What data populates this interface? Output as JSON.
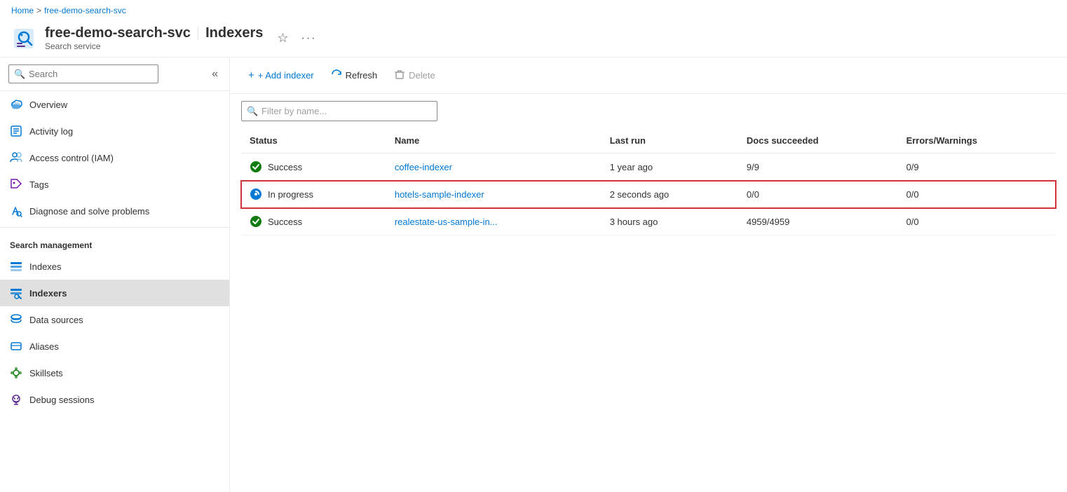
{
  "breadcrumb": {
    "home": "Home",
    "separator": ">",
    "current": "free-demo-search-svc"
  },
  "header": {
    "service_name": "free-demo-search-svc",
    "separator": "|",
    "page_title": "Indexers",
    "subtitle": "Search service",
    "star_label": "☆",
    "more_label": "···"
  },
  "sidebar": {
    "search_placeholder": "Search",
    "collapse_icon": "«",
    "items": [
      {
        "id": "overview",
        "label": "Overview",
        "icon": "cloud"
      },
      {
        "id": "activity-log",
        "label": "Activity log",
        "icon": "list"
      },
      {
        "id": "access-control",
        "label": "Access control (IAM)",
        "icon": "people"
      },
      {
        "id": "tags",
        "label": "Tags",
        "icon": "tag"
      },
      {
        "id": "diagnose",
        "label": "Diagnose and solve problems",
        "icon": "wrench"
      }
    ],
    "section_title": "Search management",
    "management_items": [
      {
        "id": "indexes",
        "label": "Indexes",
        "icon": "indexes"
      },
      {
        "id": "indexers",
        "label": "Indexers",
        "icon": "indexers",
        "active": true
      },
      {
        "id": "data-sources",
        "label": "Data sources",
        "icon": "data-sources"
      },
      {
        "id": "aliases",
        "label": "Aliases",
        "icon": "aliases"
      },
      {
        "id": "skillsets",
        "label": "Skillsets",
        "icon": "skillsets"
      },
      {
        "id": "debug-sessions",
        "label": "Debug sessions",
        "icon": "debug-sessions"
      }
    ]
  },
  "toolbar": {
    "add_indexer": "+ Add indexer",
    "refresh": "Refresh",
    "delete": "Delete"
  },
  "filter": {
    "placeholder": "Filter by name..."
  },
  "table": {
    "columns": [
      "Status",
      "Name",
      "Last run",
      "Docs succeeded",
      "Errors/Warnings"
    ],
    "rows": [
      {
        "status": "Success",
        "status_type": "success",
        "name": "coffee-indexer",
        "last_run": "1 year ago",
        "docs_succeeded": "9/9",
        "errors_warnings": "0/9",
        "highlighted": false
      },
      {
        "status": "In progress",
        "status_type": "in-progress",
        "name": "hotels-sample-indexer",
        "last_run": "2 seconds ago",
        "docs_succeeded": "0/0",
        "errors_warnings": "0/0",
        "highlighted": true
      },
      {
        "status": "Success",
        "status_type": "success",
        "name": "realestate-us-sample-in...",
        "last_run": "3 hours ago",
        "docs_succeeded": "4959/4959",
        "errors_warnings": "0/0",
        "highlighted": false
      }
    ]
  }
}
